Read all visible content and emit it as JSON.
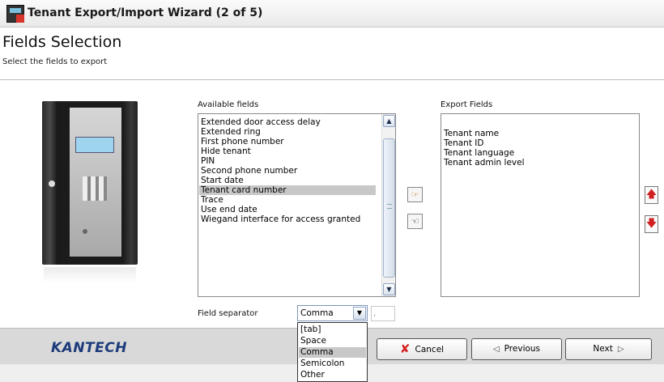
{
  "window": {
    "title": "Tenant Export/Import Wizard (2 of 5)"
  },
  "header": {
    "title": "Fields Selection",
    "subtitle": "Select the fields to export"
  },
  "available": {
    "label": "Available fields",
    "items": [
      "Extended door access delay",
      "Extended ring",
      "First phone number",
      "Hide tenant",
      "PIN",
      "Second phone number",
      "Start date",
      "Tenant card number",
      "Trace",
      "Use end date",
      "Wiegand interface for access granted"
    ],
    "selected": "Tenant card number"
  },
  "export": {
    "label": "Export Fields",
    "items": [
      "Tenant name",
      "Tenant ID",
      "Tenant language",
      "Tenant admin level"
    ]
  },
  "separator": {
    "label": "Field separator",
    "value": "Comma",
    "custom_value": ",",
    "options": [
      "[tab]",
      "Space",
      "Comma",
      "Semicolon",
      "Other"
    ]
  },
  "footer": {
    "brand": "KANTECH",
    "cancel": "Cancel",
    "previous": "Previous",
    "next": "Next"
  },
  "icons": {
    "add": "hand-right-icon",
    "remove": "hand-left-icon",
    "move_up": "arrow-up-icon",
    "move_down": "arrow-down-icon"
  },
  "colors": {
    "accent": "#1c3b7a",
    "selection": "#c8c8c8",
    "cancel": "#d42020"
  }
}
